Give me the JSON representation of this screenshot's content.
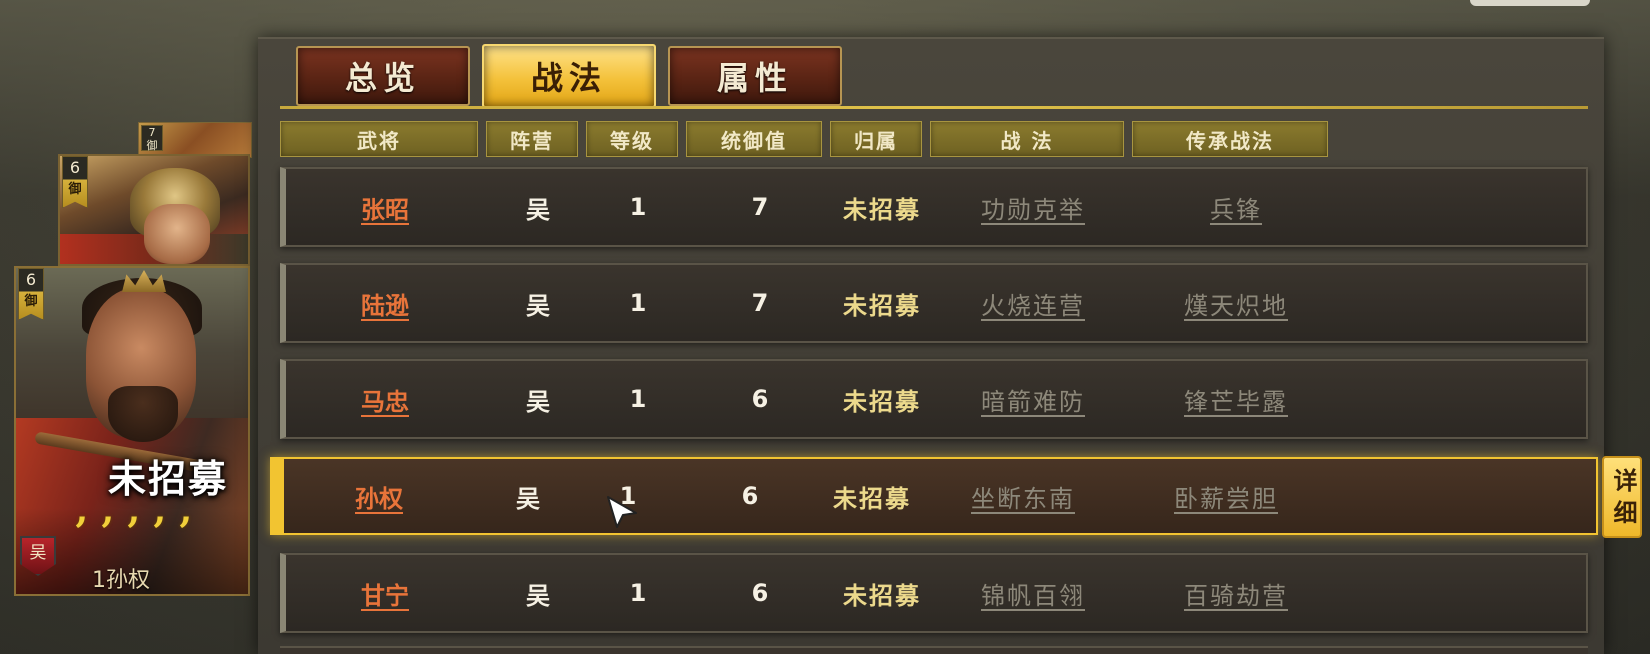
{
  "tabs": [
    {
      "label": "总览",
      "active": false
    },
    {
      "label": "战法",
      "active": true
    },
    {
      "label": "属性",
      "active": false
    }
  ],
  "columns": [
    "武将",
    "阵营",
    "等级",
    "统御值",
    "归属",
    "战  法",
    "传承战法"
  ],
  "rows": [
    {
      "name": "张昭",
      "faction": "吴",
      "level": "1",
      "command": "7",
      "status": "未招募",
      "skill": "功勋克举",
      "inherit": "兵锋",
      "selected": false
    },
    {
      "name": "陆逊",
      "faction": "吴",
      "level": "1",
      "command": "7",
      "status": "未招募",
      "skill": "火烧连营",
      "inherit": "熯天炽地",
      "selected": false
    },
    {
      "name": "马忠",
      "faction": "吴",
      "level": "1",
      "command": "6",
      "status": "未招募",
      "skill": "暗箭难防",
      "inherit": "锋芒毕露",
      "selected": false
    },
    {
      "name": "孙权",
      "faction": "吴",
      "level": "1",
      "command": "6",
      "status": "未招募",
      "skill": "坐断东南",
      "inherit": "卧薪尝胆",
      "selected": true
    },
    {
      "name": "甘宁",
      "faction": "吴",
      "level": "1",
      "command": "6",
      "status": "未招募",
      "skill": "锦帆百翎",
      "inherit": "百骑劫营",
      "selected": false
    }
  ],
  "detail_button": "详细",
  "cards": {
    "small": {
      "cost": "7",
      "class": "御"
    },
    "mid": {
      "cost": "6",
      "class": "御"
    },
    "main": {
      "cost": "6",
      "class": "御",
      "status": "未招募",
      "stars": 5,
      "faction": "吴",
      "name": "1孙权"
    }
  },
  "colors": {
    "accent_gold": "#f2c431",
    "name_orange": "#e8743a",
    "status_yellow": "#ecd98c",
    "skill_gray": "#8d887a",
    "tab_red": "#5a2414"
  }
}
